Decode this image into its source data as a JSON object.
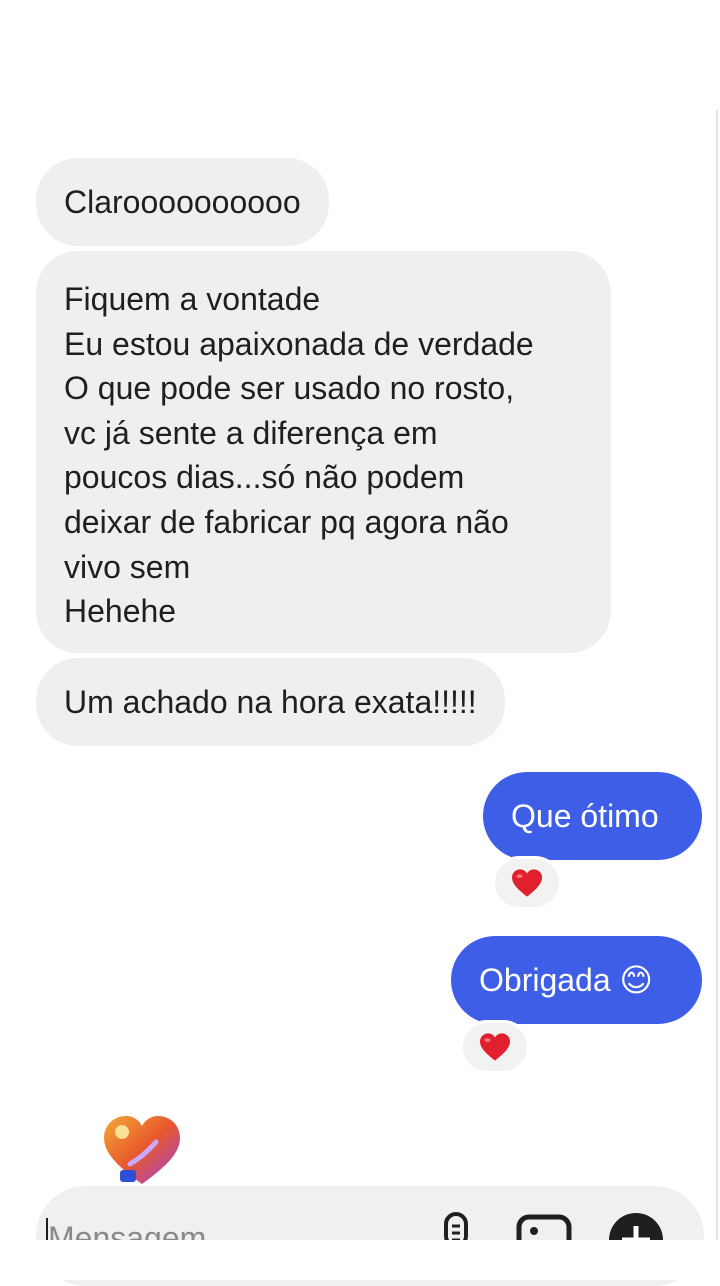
{
  "messages": {
    "incoming": [
      "Claroooooooooo",
      "Fiquem a vontade\nEu estou apaixonada de verdade\nO que pode ser usado no rosto,\nvc já sente a diferença em\npoucos dias...só não podem\ndeixar de fabricar pq agora não\nvivo sem\nHehehe",
      "Um achado na hora exata!!!!!"
    ],
    "outgoing": [
      {
        "text": "Que ótimo",
        "reaction": "❤️"
      },
      {
        "text": "Obrigada 😊",
        "reaction": "❤️"
      }
    ]
  },
  "composer": {
    "placeholder": "Mensagem",
    "icons": [
      "microphone-icon",
      "image-icon",
      "add-icon"
    ]
  },
  "sticker": {
    "name": "heart-sticker"
  },
  "colors": {
    "incoming_bubble": "#efefef",
    "outgoing_bubble": "#3f5ee8",
    "reaction_heart": "#e0202e",
    "composer_bg": "#f0f0f0"
  }
}
